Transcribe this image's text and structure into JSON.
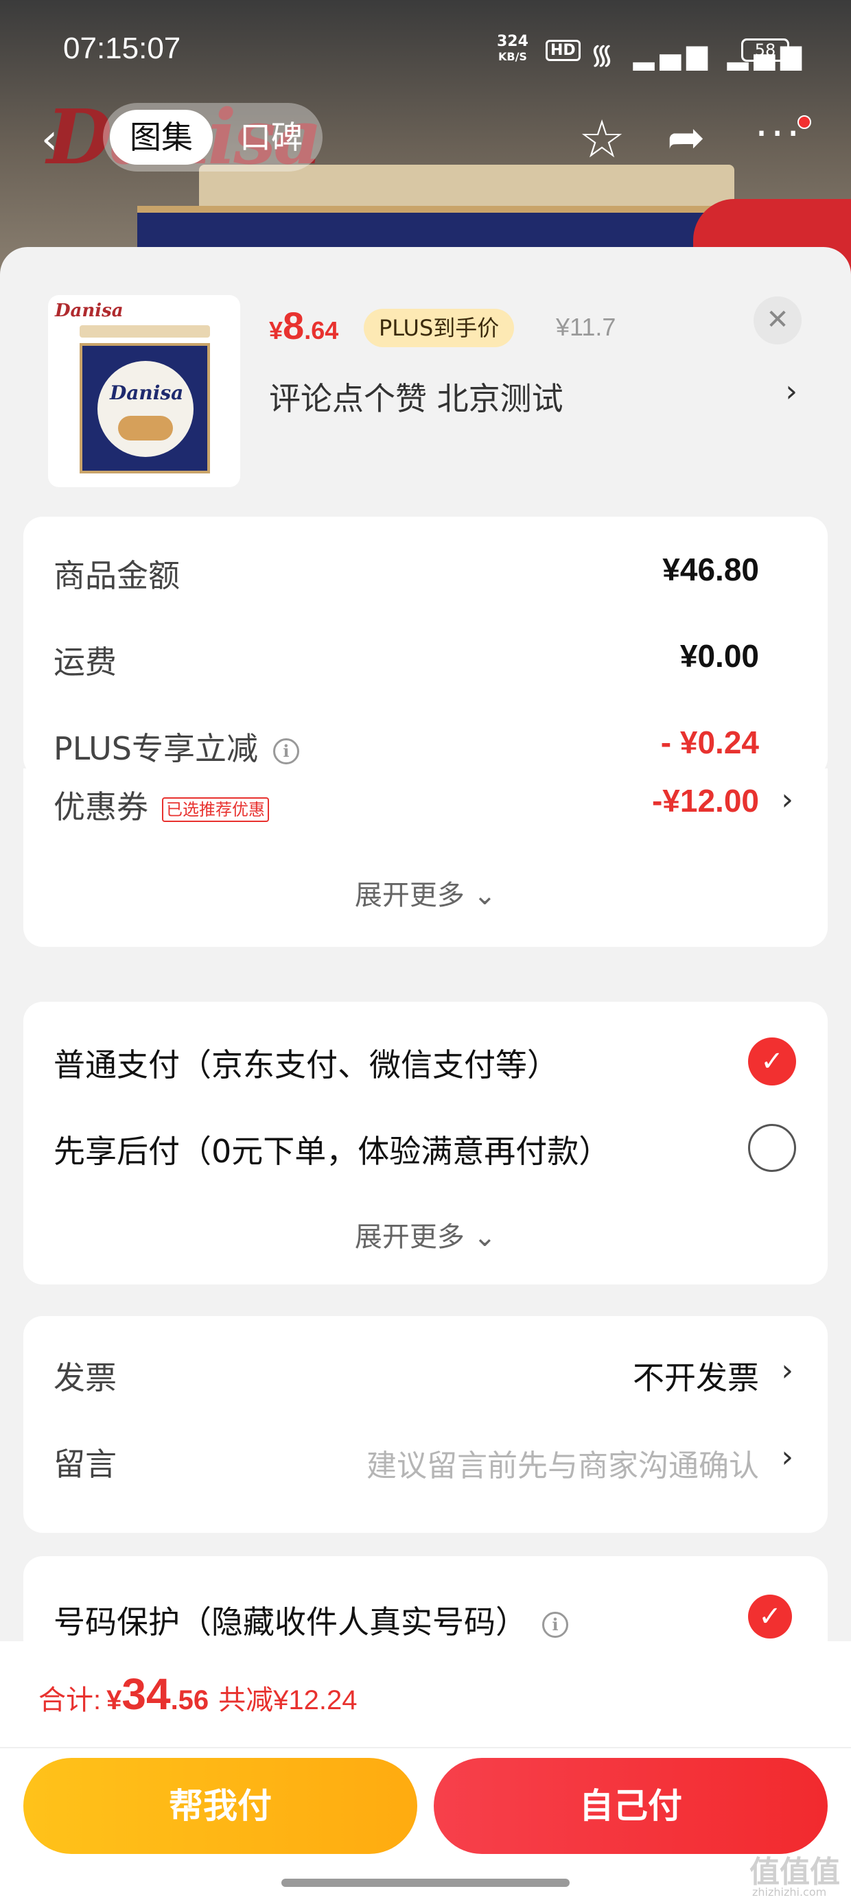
{
  "status_bar": {
    "time": "07:15:07",
    "net_speed": "324",
    "net_unit": "KB/S",
    "hd": "HD",
    "signal_icons": "᯾ ▂▄▆ ▂▄▆",
    "battery": "58"
  },
  "nav": {
    "tab_gallery": "图集",
    "tab_reviews": "口碑",
    "bg_brand": "Danisa"
  },
  "product": {
    "thumb_brand": "Danisa",
    "tin_brand": "Danisa",
    "price_yen": "¥",
    "price_int": "8",
    "price_dec": ".64",
    "plus_badge": "PLUS到手价",
    "original_price": "¥11.7",
    "spec": "评论点个赞  北京测试"
  },
  "summary": {
    "goods_amount_label": "商品金额",
    "goods_amount": "¥46.80",
    "shipping_label": "运费",
    "shipping": "¥0.00",
    "plus_discount_label": "PLUS专享立减",
    "plus_discount": "- ¥0.24",
    "coupon_label": "优惠券",
    "coupon_tag": "已选推荐优惠",
    "coupon_value": "-¥12.00",
    "expand": "展开更多 ⌄"
  },
  "payment": {
    "option_normal": "普通支付（京东支付、微信支付等）",
    "option_later": "先享后付（0元下单，体验满意再付款）",
    "expand": "展开更多 ⌄"
  },
  "extras": {
    "invoice_label": "发票",
    "invoice_value": "不开发票",
    "message_label": "留言",
    "message_placeholder": "建议留言前先与商家沟通确认"
  },
  "privacy": {
    "label": "号码保护（隐藏收件人真实号码）"
  },
  "bottom": {
    "total_label": "合计:",
    "total_yen": "¥",
    "total_int": "34",
    "total_dec": ".56",
    "total_saving": "共减¥12.24",
    "help_pay": "帮我付",
    "self_pay": "自己付",
    "watermark": "值值值",
    "watermark_url": "zhizhizhi.com"
  },
  "colors": {
    "accent_red": "#e8322f",
    "help_button": "#ffb815",
    "plus_badge_bg": "#fde9b4"
  }
}
